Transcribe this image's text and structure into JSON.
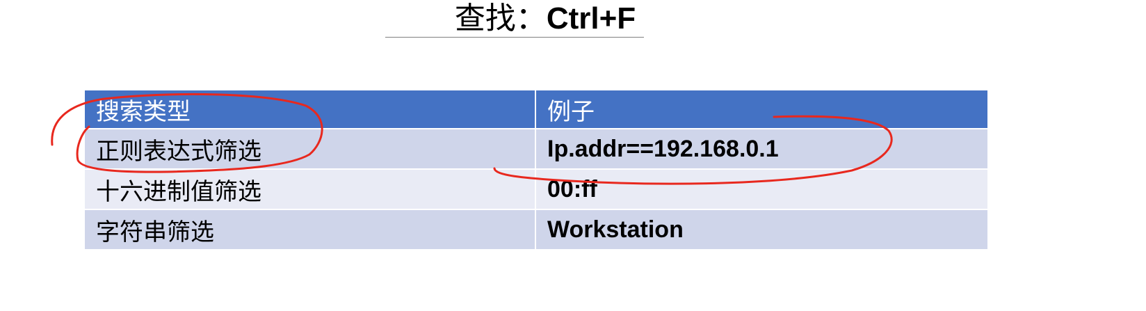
{
  "title": {
    "label": "查找：",
    "shortcut": "Ctrl+F"
  },
  "table": {
    "headers": [
      "搜索类型",
      "例子"
    ],
    "rows": [
      {
        "type": "正则表达式筛选",
        "example": "Ip.addr==192.168.0.1"
      },
      {
        "type": "十六进制值筛选",
        "example": "00:ff"
      },
      {
        "type": "字符串筛选",
        "example": "Workstation"
      }
    ]
  },
  "colors": {
    "header_bg": "#4472c4",
    "row_dark": "#cfd5ea",
    "row_light": "#e9ebf5",
    "annotation": "#e8281e"
  }
}
